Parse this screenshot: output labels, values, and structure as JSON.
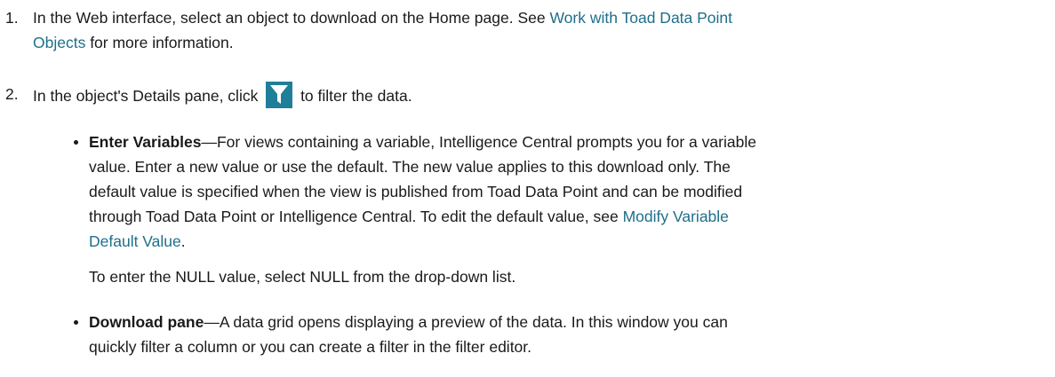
{
  "steps": [
    {
      "number": "1.",
      "text_before": "In the Web interface, select an object to download on the Home page. See ",
      "link_line1": "Work with Toad Data Point",
      "link_line2": "Objects",
      "text_after": " for more information."
    },
    {
      "number": "2.",
      "text_before": "In the object's Details pane, click ",
      "icon": "filter-icon",
      "text_after": " to filter the data."
    }
  ],
  "bullets": [
    {
      "term": "Enter Variables",
      "lines": [
        "—For views containing a variable, Intelligence Central prompts you for a variable",
        "value. Enter a new value or use the default. The new value applies to this download only. The",
        "default value is specified when the view is published from Toad Data Point and can be modified",
        "through Toad Data Point or Intelligence Central. To edit the default value, see "
      ],
      "link_line1": "Modify Variable",
      "link_line2": "Default Value",
      "trailing": "."
    },
    {
      "term": "Download pane",
      "lines": [
        "—A data grid opens displaying a preview of the data. In this window you can",
        "quickly filter a column or you can create a filter in the filter editor."
      ]
    }
  ],
  "note": "To enter the NULL value, select NULL from the drop-down list.",
  "colors": {
    "link": "#1e6f8a",
    "icon_bg": "#1f7e98",
    "text": "#1a1a1a"
  }
}
